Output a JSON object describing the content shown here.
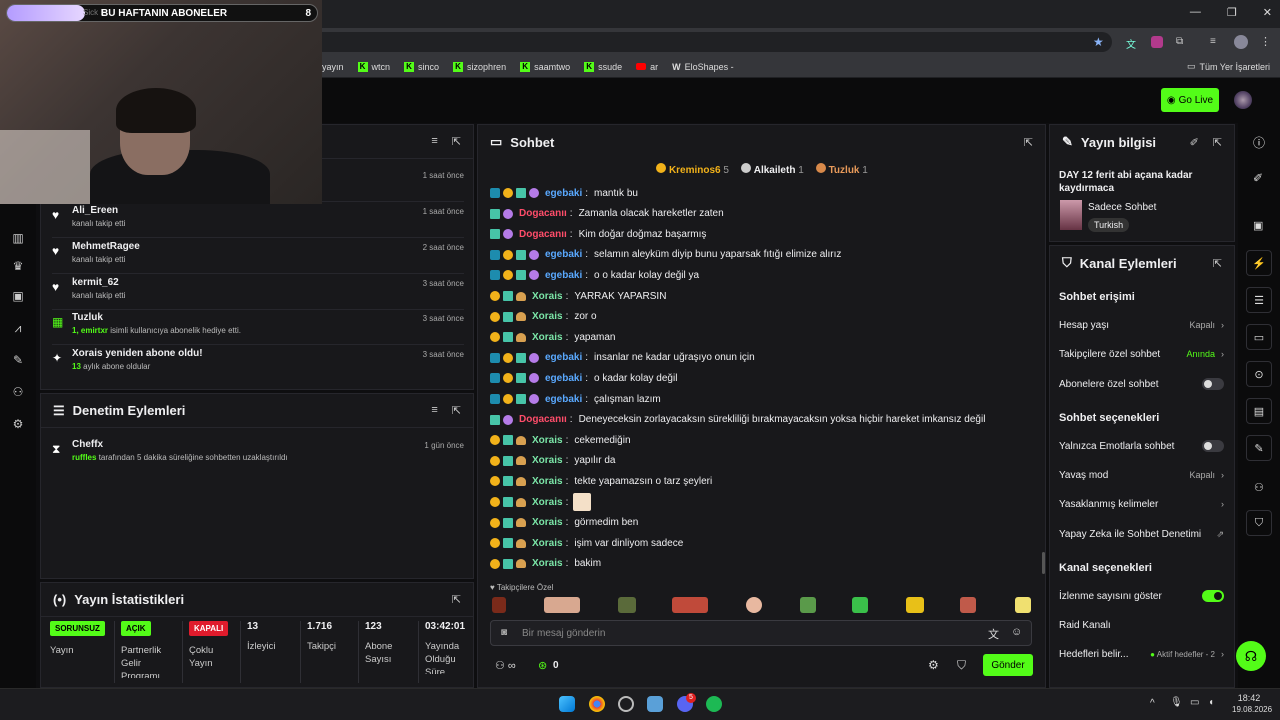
{
  "browser": {
    "bookmarks": [
      "yayın",
      "wtcn",
      "sinco",
      "sizophren",
      "saamtwo",
      "ssude",
      "ar",
      "EloShapes -"
    ],
    "all_bookmarks_label": "Tüm Yer İşaretleri"
  },
  "overlay": {
    "title": "BU HAFTANIN ABONELER",
    "count": "8",
    "hint": "Sick E"
  },
  "header": {
    "go_live": "Go Live"
  },
  "activity": {
    "items": [
      {
        "name": "",
        "desc": "",
        "time": "1 saat önce"
      },
      {
        "name": "Ali_Ereen",
        "desc": "kanalı takip etti",
        "time": "1 saat önce"
      },
      {
        "name": "MehmetRagee",
        "desc": "kanalı takip etti",
        "time": "2 saat önce"
      },
      {
        "name": "kermit_62",
        "desc": "kanalı takip etti",
        "time": "3 saat önce"
      },
      {
        "name": "Tuzluk",
        "desc_user": "1, emirtxr",
        "desc": "isimli kullanıcıya abonelik hediye etti.",
        "time": "3 saat önce"
      },
      {
        "name": "Xorais yeniden abone oldu!",
        "desc_num": "13",
        "desc": "aylık abone oldular",
        "time": "3 saat önce"
      }
    ]
  },
  "moderation": {
    "title": "Denetim Eylemleri",
    "item": {
      "name": "Cheffx",
      "user": "ruffles",
      "desc": "tarafından 5 dakika süreliğine sohbetten uzaklaştırıldı",
      "time": "1 gün önce"
    }
  },
  "stats": {
    "title": "Yayın İstatistikleri",
    "cells": [
      {
        "pill": "SORUNSUZ",
        "label": "Yayın"
      },
      {
        "pill": "AÇIK",
        "label": "Partnerlik Gelir Programı"
      },
      {
        "pill": "KAPALI",
        "label": "Çoklu Yayın"
      },
      {
        "value": "13",
        "label": "İzleyici"
      },
      {
        "value": "1.716",
        "label": "Takipçi"
      },
      {
        "value": "123",
        "label": "Abone Sayısı"
      },
      {
        "value": "03:42:01",
        "label": "Yayında Olduğu Süre"
      }
    ]
  },
  "chat": {
    "title": "Sohbet",
    "top_gifters": [
      {
        "name": "Kreminos6",
        "count": "5"
      },
      {
        "name": "Alkaileth",
        "count": "1"
      },
      {
        "name": "Tuzluk",
        "count": "1"
      }
    ],
    "messages": [
      {
        "user": "egebaki",
        "color": "#5aa9ff",
        "text": "mantık bu",
        "badges": [
          "b1",
          "b2",
          "b3",
          "b4"
        ]
      },
      {
        "user": "Dogacanıı",
        "color": "#ff4d6a",
        "text": "Zamanla olacak hareketler zaten",
        "badges": [
          "b3",
          "b4"
        ]
      },
      {
        "user": "Dogacanıı",
        "color": "#ff4d6a",
        "text": "Kim doğar doğmaz başarmış",
        "badges": [
          "b3",
          "b4"
        ]
      },
      {
        "user": "egebaki",
        "color": "#5aa9ff",
        "text": "selamın aleyküm diyip bunu yaparsak fıtığı elimize alırız",
        "badges": [
          "b1",
          "b2",
          "b3",
          "b4"
        ]
      },
      {
        "user": "egebaki",
        "color": "#5aa9ff",
        "text": "o o kadar kolay değil ya",
        "badges": [
          "b1",
          "b2",
          "b3",
          "b4"
        ]
      },
      {
        "user": "Xorais",
        "color": "#7be6a8",
        "text": "YARRAK YAPARSIN",
        "badges": [
          "b2",
          "b3",
          "b5"
        ]
      },
      {
        "user": "Xorais",
        "color": "#7be6a8",
        "text": "zor o",
        "badges": [
          "b2",
          "b3",
          "b5"
        ]
      },
      {
        "user": "Xorais",
        "color": "#7be6a8",
        "text": "yapaman",
        "badges": [
          "b2",
          "b3",
          "b5"
        ]
      },
      {
        "user": "egebaki",
        "color": "#5aa9ff",
        "text": "insanlar ne kadar uğraşıyo onun için",
        "badges": [
          "b1",
          "b2",
          "b3",
          "b4"
        ]
      },
      {
        "user": "egebaki",
        "color": "#5aa9ff",
        "text": "o kadar kolay değil",
        "badges": [
          "b1",
          "b2",
          "b3",
          "b4"
        ]
      },
      {
        "user": "egebaki",
        "color": "#5aa9ff",
        "text": "çalışman lazım",
        "badges": [
          "b1",
          "b2",
          "b3",
          "b4"
        ]
      },
      {
        "user": "Dogacanıı",
        "color": "#ff4d6a",
        "text": "Deneyeceksin zorlayacaksın sürekliliği bırakmayacaksın yoksa hiçbir hareket imkansız değil",
        "badges": [
          "b3",
          "b4"
        ]
      },
      {
        "user": "Xorais",
        "color": "#7be6a8",
        "text": "cekemediğin",
        "badges": [
          "b2",
          "b3",
          "b5"
        ]
      },
      {
        "user": "Xorais",
        "color": "#7be6a8",
        "text": "yapılır da",
        "badges": [
          "b2",
          "b3",
          "b5"
        ]
      },
      {
        "user": "Xorais",
        "color": "#7be6a8",
        "text": "tekte yapamazsın o tarz şeyleri",
        "badges": [
          "b2",
          "b3",
          "b5"
        ]
      },
      {
        "user": "Xorais",
        "color": "#7be6a8",
        "text": "",
        "emote": true,
        "badges": [
          "b2",
          "b3",
          "b5"
        ]
      },
      {
        "user": "Xorais",
        "color": "#7be6a8",
        "text": "görmedim ben",
        "badges": [
          "b2",
          "b3",
          "b5"
        ]
      },
      {
        "user": "Xorais",
        "color": "#7be6a8",
        "text": "işim var dinliyom sadece",
        "badges": [
          "b2",
          "b3",
          "b5"
        ]
      },
      {
        "user": "Xorais",
        "color": "#7be6a8",
        "text": "bakim",
        "badges": [
          "b2",
          "b3",
          "b5"
        ]
      }
    ],
    "followers_only_label": "Takipçilere Özel",
    "input_placeholder": "Bir mesaj gönderin",
    "points": "0",
    "send_label": "Gönder"
  },
  "stream_info": {
    "title": "Yayın bilgisi",
    "stream_title": "DAY 12 ferit abi açana kadar kaydırmaca",
    "category": "Sadece Sohbet",
    "language": "Turkish"
  },
  "channel_actions": {
    "title": "Kanal Eylemleri",
    "chat_access_heading": "Sohbet erişimi",
    "account_age": {
      "label": "Hesap yaşı",
      "value": "Kapalı"
    },
    "followers_only": {
      "label": "Takipçilere özel sohbet",
      "value": "Anında"
    },
    "subs_only": {
      "label": "Abonelere özel sohbet"
    },
    "chat_options_heading": "Sohbet seçenekleri",
    "emote_only": {
      "label": "Yalnızca Emotlarla sohbet"
    },
    "slow_mode": {
      "label": "Yavaş mod",
      "value": "Kapalı"
    },
    "banned_words": {
      "label": "Yasaklanmış kelimeler"
    },
    "ai_moderation": {
      "label": "Yapay Zeka ile Sohbet Denetimi"
    },
    "channel_options_heading": "Kanal seçenekleri",
    "show_viewers": {
      "label": "İzlenme sayısını göster"
    },
    "raid": {
      "label": "Raid Kanalı"
    },
    "goals": {
      "label": "Hedefleri belir...",
      "value": "Aktif hedefler - 2"
    }
  },
  "taskbar": {
    "time": "18:42",
    "date": "19.08.2026",
    "discord_badge": "5"
  },
  "colors": {
    "accent": "#53fc18",
    "panel": "#18181b",
    "background": "#0e0e10"
  }
}
